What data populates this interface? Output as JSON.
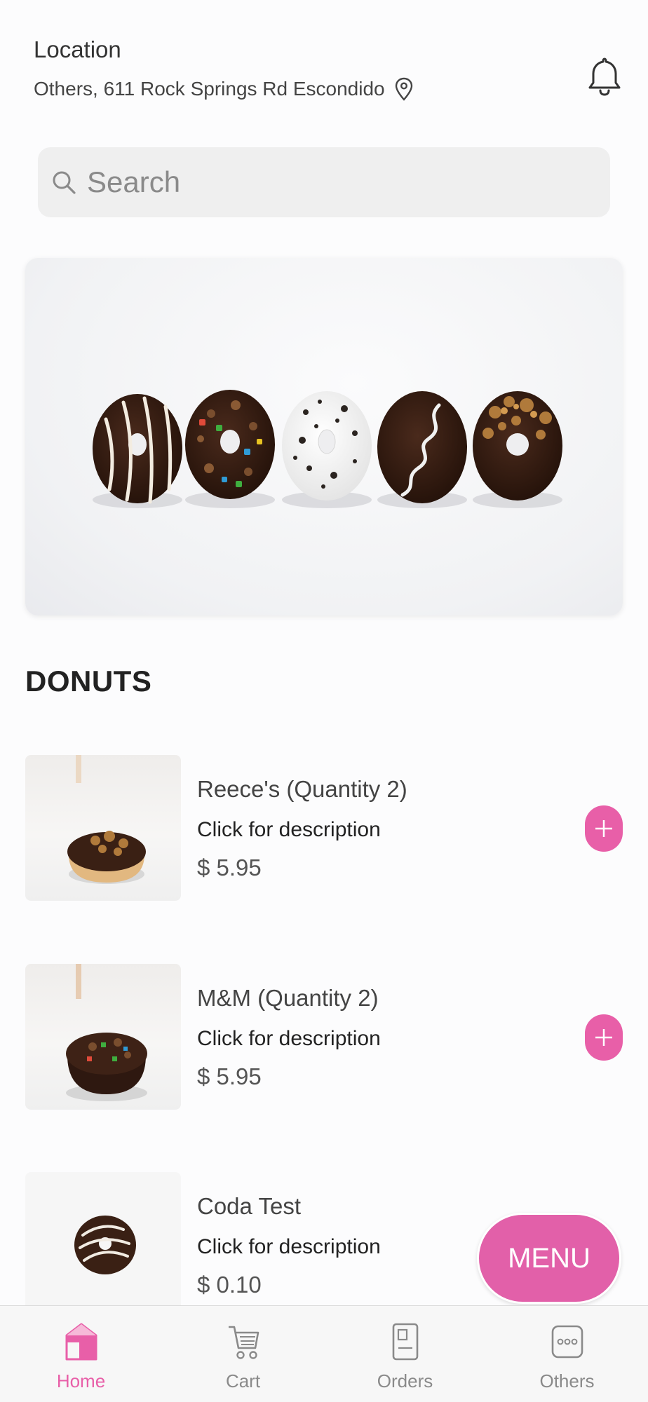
{
  "header": {
    "title": "Location",
    "address": "Others, 611 Rock Springs Rd Escondido"
  },
  "search": {
    "placeholder": "Search"
  },
  "section": {
    "title": "DONUTS"
  },
  "items": [
    {
      "name": "Reece's (Quantity 2)",
      "description": "Click for description",
      "price": "$ 5.95"
    },
    {
      "name": "M&M  (Quantity 2)",
      "description": "Click for description",
      "price": "$ 5.95"
    },
    {
      "name": "Coda Test",
      "description": "Click for description",
      "price": "$ 0.10"
    }
  ],
  "menu_fab": {
    "label": "MENU"
  },
  "tabbar": {
    "tabs": [
      {
        "label": "Home",
        "icon": "home-icon",
        "active": true
      },
      {
        "label": "Cart",
        "icon": "cart-icon",
        "active": false
      },
      {
        "label": "Orders",
        "icon": "orders-icon",
        "active": false
      },
      {
        "label": "Others",
        "icon": "more-icon",
        "active": false
      }
    ]
  },
  "colors": {
    "accent": "#e85fa8",
    "background": "#fcfcfd"
  }
}
